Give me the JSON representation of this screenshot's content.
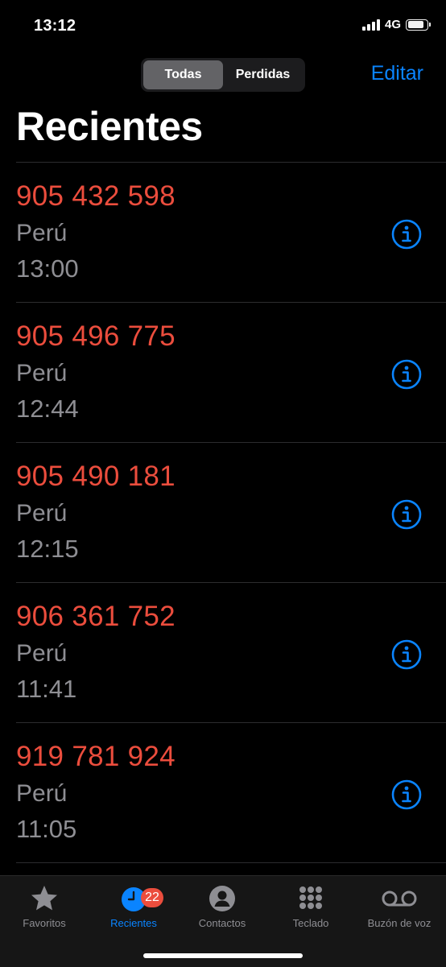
{
  "status_bar": {
    "time": "13:12",
    "network": "4G",
    "battery_level": 0.85
  },
  "header": {
    "segments": [
      {
        "label": "Todas",
        "selected": true
      },
      {
        "label": "Perdidas",
        "selected": false
      }
    ],
    "edit_label": "Editar",
    "title": "Recientes"
  },
  "calls": [
    {
      "number": "905 432 598",
      "location": "Perú",
      "time": "13:00"
    },
    {
      "number": "905 496 775",
      "location": "Perú",
      "time": "12:44"
    },
    {
      "number": "905 490 181",
      "location": "Perú",
      "time": "12:15"
    },
    {
      "number": "906 361 752",
      "location": "Perú",
      "time": "11:41"
    },
    {
      "number": "919 781 924",
      "location": "Perú",
      "time": "11:05"
    }
  ],
  "tab_bar": {
    "tabs": [
      {
        "label": "Favoritos",
        "icon": "star-icon",
        "active": false
      },
      {
        "label": "Recientes",
        "icon": "clock-icon",
        "active": true,
        "badge": "22"
      },
      {
        "label": "Contactos",
        "icon": "person-icon",
        "active": false
      },
      {
        "label": "Teclado",
        "icon": "keypad-icon",
        "active": false
      },
      {
        "label": "Buzón de voz",
        "icon": "voicemail-icon",
        "active": false
      }
    ]
  },
  "colors": {
    "accent": "#0a84ff",
    "missed": "#eb4d3d",
    "secondary_text": "#8e8e93",
    "background": "#000000"
  }
}
